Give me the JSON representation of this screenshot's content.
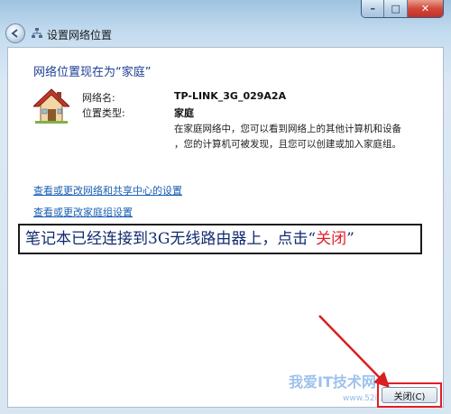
{
  "window": {
    "title": "设置网络位置",
    "controls": {
      "minimize": "–",
      "maximize": "□",
      "close": "✕"
    }
  },
  "content": {
    "heading": "网络位置现在为“家庭”",
    "network_name_label": "网络名:",
    "network_name_value": "TP-LINK_3G_029A2A",
    "location_type_label": "位置类型:",
    "location_type_value": "家庭",
    "description_line1": "在家庭网络中，您可以看到网络上的其他计算机和设备",
    "description_line2": "，您的计算机可被发现，且您可以创建或加入家庭组。",
    "link_sharing_center": "查看或更改网络和共享中心的设置",
    "link_homegroup": "查看或更改家庭组设置"
  },
  "annotation": {
    "callout_text": "笔记本已经连接到3G无线路由器上，点击“",
    "callout_highlight": "关闭",
    "callout_end": "”",
    "highlight_color": "#e0202a",
    "arrow_color": "#d62020"
  },
  "footer": {
    "close_button_label": "关闭(C)"
  },
  "watermark": {
    "brand": "我爱IT技术网",
    "url": "www.52ij.com"
  }
}
